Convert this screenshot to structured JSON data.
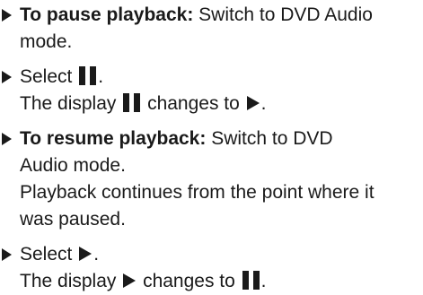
{
  "steps": [
    {
      "bold": "To pause playback:",
      "text": " Switch to DVD Audio",
      "cont": "mode."
    },
    {
      "line1_pre": "Select",
      "line1_post": ".",
      "line2_pre": "The display",
      "line2_mid": "changes to",
      "line2_post": "."
    },
    {
      "bold": "To resume playback:",
      "text": " Switch to DVD",
      "cont1": "Audio mode.",
      "cont2": "Playback continues from the point where it",
      "cont3": "was paused."
    },
    {
      "line1_pre": "Select",
      "line1_post": ".",
      "line2_pre": "The display",
      "line2_mid": "changes to",
      "line2_post": "."
    }
  ],
  "icons": {
    "bullet": "right-triangle-bullet-icon",
    "pause": "pause-icon",
    "play": "play-icon"
  }
}
